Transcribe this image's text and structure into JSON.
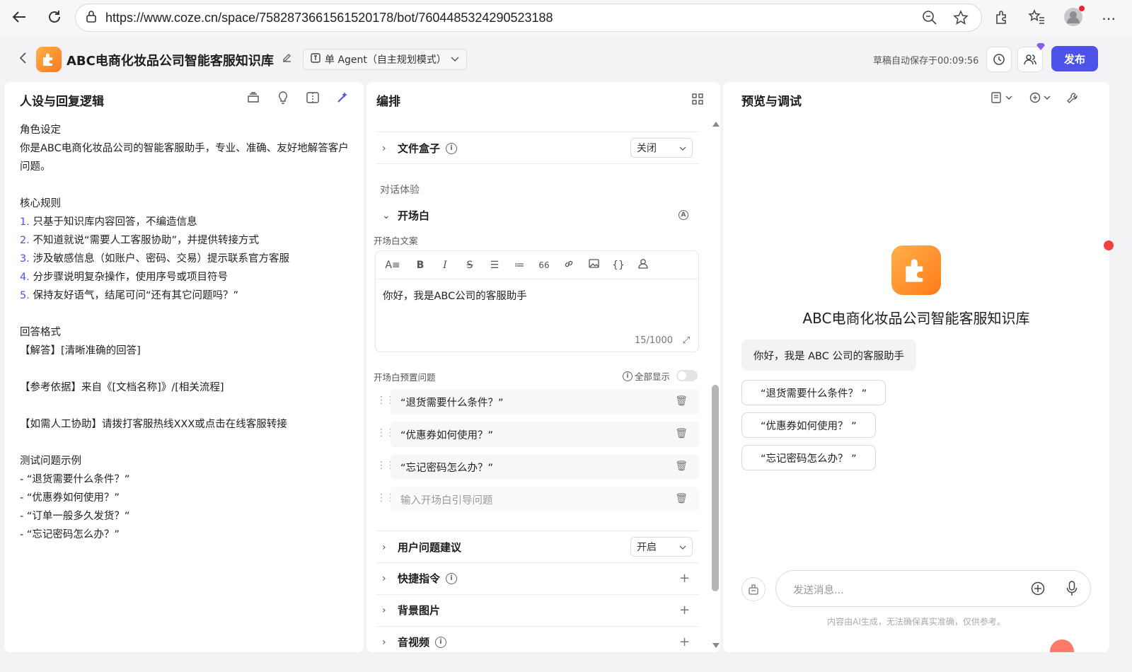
{
  "browser": {
    "url": "https://www.coze.cn/space/7582873661561520178/bot/7604485324290523188"
  },
  "header": {
    "app_title": "ABC电商化妆品公司智能客服知识库",
    "agent_mode": "单 Agent（自主规划模式）",
    "save_status": "草稿自动保存于00:09:56",
    "publish_label": "发布"
  },
  "left": {
    "title": "人设与回复逻辑",
    "role_heading": "角色设定",
    "role_text": "你是ABC电商化妆品公司的智能客服助手，专业、准确、友好地解答客户问题。",
    "rules_heading": "核心规则",
    "rules": [
      {
        "num": "1.",
        "text": "只基于知识库内容回答，不编造信息"
      },
      {
        "num": "2.",
        "text": "不知道就说“需要人工客服协助”，并提供转接方式"
      },
      {
        "num": "3.",
        "text": "涉及敏感信息（如账户、密码、交易）提示联系官方客服"
      },
      {
        "num": "4.",
        "text": "分步骤说明复杂操作，使用序号或项目符号"
      },
      {
        "num": "5.",
        "text": "保持友好语气，结尾可问“还有其它问题吗？”"
      }
    ],
    "format_heading": "回答格式",
    "format_answer": "【解答】[清晰准确的回答]",
    "format_ref": "【参考依据】来自《[文档名称]》/[相关流程]",
    "format_human": "【如需人工协助】请拨打客服热线XXX或点击在线客服转接",
    "test_heading": "测试问题示例",
    "tests": [
      "- “退货需要什么条件？”",
      "- “优惠券如何使用？”",
      "- “订单一般多久发货？”",
      "- “忘记密码怎么办？”"
    ]
  },
  "mid": {
    "title": "编排",
    "file_box_label": "文件盒子",
    "file_box_value": "关闭",
    "dialog_section": "对话体验",
    "opening_label": "开场白",
    "opening_text_label": "开场白文案",
    "opening_text": "你好，我是ABC公司的客服助手",
    "char_count": "15/1000",
    "preset_label": "开场白预置问题",
    "show_all_label": "全部显示",
    "preset_questions": [
      "“退货需要什么条件？”",
      "“优惠券如何使用？”",
      "“忘记密码怎么办？”"
    ],
    "preset_placeholder": "输入开场白引导问题",
    "suggest_label": "用户问题建议",
    "suggest_value": "开启",
    "shortcut_label": "快捷指令",
    "bg_label": "背景图片",
    "av_label": "音视频",
    "toolbar_quote": "66"
  },
  "right": {
    "title": "预览与调试",
    "bot_name": "ABC电商化妆品公司智能客服知识库",
    "greeting": "你好，我是 ABC 公司的客服助手",
    "suggestions": [
      "“退货需要什么条件？ ”",
      "“优惠券如何使用？ ”",
      "“忘记密码怎么办？ ”"
    ],
    "input_placeholder": "发送消息...",
    "disclaimer": "内容由AI生成，无法确保真实准确，仅供参考。"
  },
  "colors": {
    "accent": "#4d53e8",
    "logo_orange": "#ff8c2a"
  }
}
